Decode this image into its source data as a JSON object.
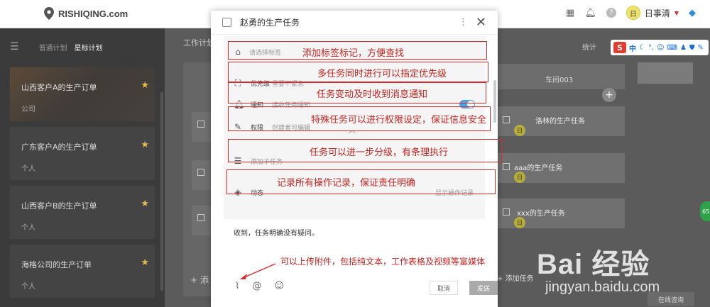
{
  "topbar": {
    "logo_text": "RISHIQING.com",
    "user_initial": "日",
    "username": "日事清"
  },
  "left_panel": {
    "tabs": [
      "普通计划",
      "星标计划"
    ],
    "cards": [
      {
        "title": "山西客户A的生产订单",
        "sub": "公司"
      },
      {
        "title": "广东客户A的生产订单",
        "sub": "个人"
      },
      {
        "title": "山西客户B的生产订单",
        "sub": "个人"
      },
      {
        "title": "海格公司的生产订单",
        "sub": "个人"
      }
    ]
  },
  "board": {
    "header": "工作计划",
    "column_title": "车间003",
    "stats": "统计",
    "tasks": [
      {
        "title": "洛林的生产任务",
        "initial": "日"
      },
      {
        "title": "aaa的生产任务",
        "initial": "日"
      },
      {
        "title": "xxx的生产任务",
        "initial": "日"
      }
    ],
    "add_task": "添加任务"
  },
  "modal": {
    "title": "赵勇的生产任务",
    "rows": {
      "tag": {
        "label": "请选择标签"
      },
      "priority": {
        "label": "优先级",
        "value": "重要不紧急"
      },
      "notify": {
        "label": "通知",
        "value": "接收任务通知"
      },
      "permission": {
        "label": "权限",
        "value": "创建者可编辑"
      },
      "subtask": {
        "label": "添加子任务"
      },
      "activity": {
        "label": "动态",
        "right": "显示操作记录"
      }
    },
    "comment_text": "收到，任务明确没有疑问。",
    "cancel": "取消",
    "send": "发送"
  },
  "annotations": {
    "a1": "添加标签标记，方便查找",
    "a2": "多任务同时进行可以指定优先级",
    "a3": "任务变动及时收到消息通知",
    "a4": "特殊任务可以进行权限设定，保证信息安全",
    "a5": "任务可以进一步分级，有条理执行",
    "a6": "记录所有操作记录，保证责任明确",
    "a7": "可以上传附件，包括纯文本，工作表格及视频等富媒体"
  },
  "watermark": {
    "brand": "Bai 经验",
    "url": "jingyan.baidu.com"
  },
  "sogou": {
    "label": "中"
  },
  "green_badge": "65",
  "online_chat": "在线咨询"
}
